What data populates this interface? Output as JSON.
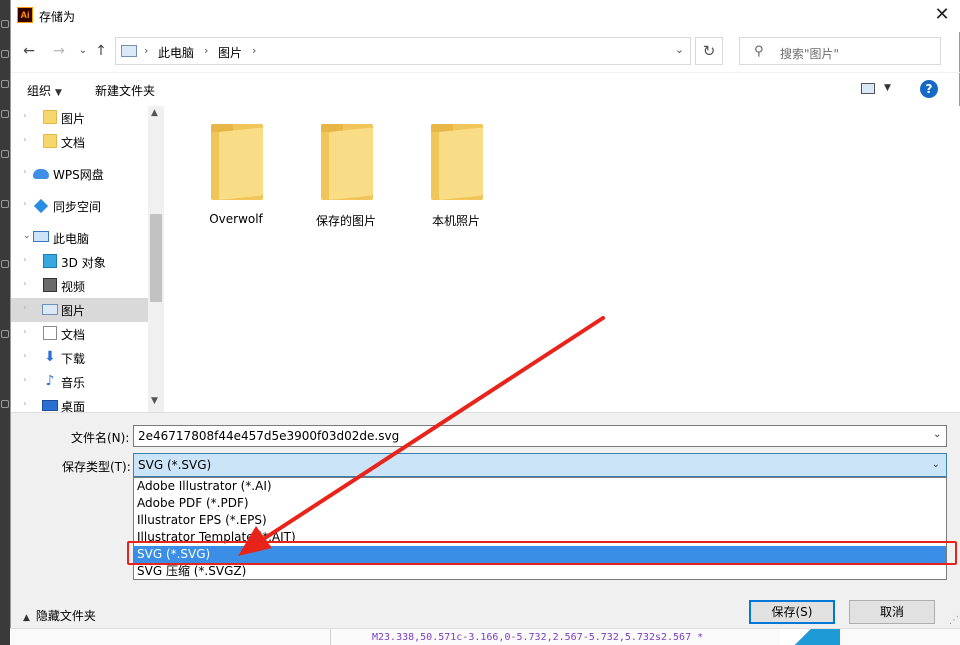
{
  "dialog": {
    "title": "存储为",
    "app_icon_text": "Ai",
    "close_glyph": "✕"
  },
  "address": {
    "crumbs": [
      "此电脑",
      "图片"
    ],
    "separator": "›"
  },
  "search": {
    "placeholder": "搜索\"图片\""
  },
  "toolbar": {
    "organize_label": "组织",
    "new_folder_label": "新建文件夹",
    "help_glyph": "?"
  },
  "nav_pane": {
    "items": [
      {
        "label": "图片",
        "icon": "folder-icon"
      },
      {
        "label": "文档",
        "icon": "folder-icon"
      },
      {
        "label": "WPS网盘",
        "icon": "cloud-icon"
      },
      {
        "label": "同步空间",
        "icon": "sync-icon"
      },
      {
        "label": "此电脑",
        "icon": "computer-icon"
      },
      {
        "label": "3D 对象",
        "icon": "3d-objects-icon"
      },
      {
        "label": "视频",
        "icon": "video-icon"
      },
      {
        "label": "图片",
        "icon": "pictures-icon",
        "selected": true
      },
      {
        "label": "文档",
        "icon": "document-icon"
      },
      {
        "label": "下载",
        "icon": "download-icon"
      },
      {
        "label": "音乐",
        "icon": "music-icon"
      },
      {
        "label": "桌面",
        "icon": "desktop-icon"
      }
    ]
  },
  "content": {
    "folders": [
      {
        "label": "Overwolf"
      },
      {
        "label": "保存的图片"
      },
      {
        "label": "本机照片"
      }
    ]
  },
  "form": {
    "filename_label": "文件名(N):",
    "filename_value": "2e46717808f44e457d5e3900f03d02de.svg",
    "type_label": "保存类型(T):",
    "type_value": "SVG (*.SVG)",
    "type_options": [
      "Adobe Illustrator (*.AI)",
      "Adobe PDF (*.PDF)",
      "Illustrator EPS (*.EPS)",
      "Illustrator Template (*.AIT)",
      "SVG (*.SVG)",
      "SVG 压缩 (*.SVGZ)"
    ],
    "highlighted_option_index": 4
  },
  "footer": {
    "hide_folders_label": "隐藏文件夹",
    "save_label": "保存(S)",
    "cancel_label": "取消"
  },
  "background": {
    "code_snippet": "M23.338,50.571c-3.166,0-5.732,2.567-5.732,5.732s2.567 *"
  },
  "colors": {
    "annotation_red": "#e8241a",
    "highlight_blue": "#3a8ee6",
    "selected_gray": "#d9d9d9"
  }
}
